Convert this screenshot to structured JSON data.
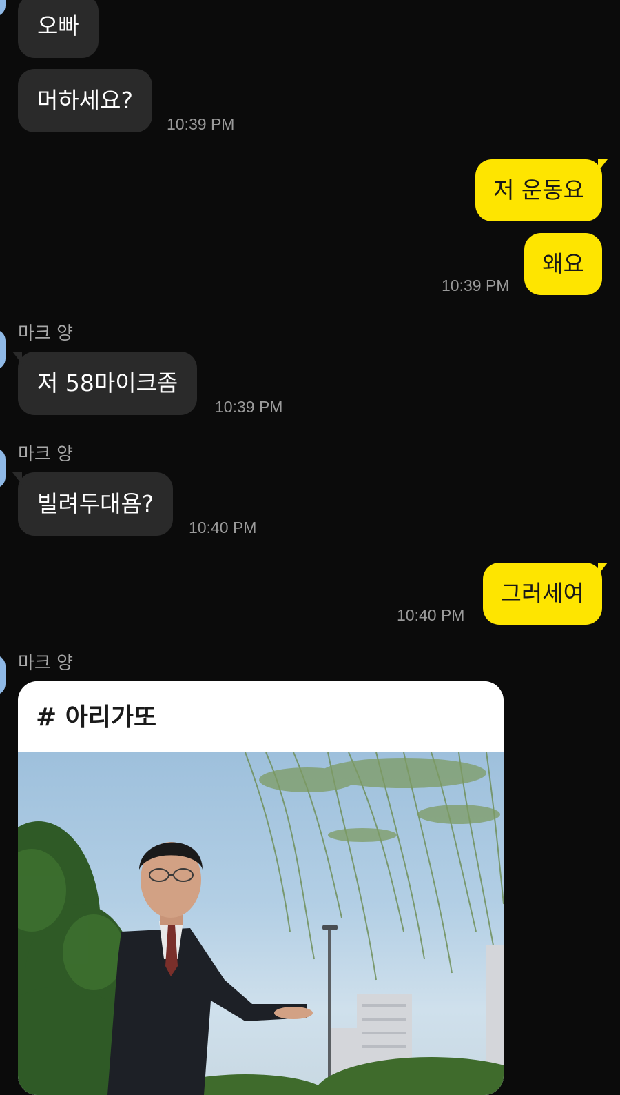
{
  "messages": [
    {
      "text": "오빠"
    },
    {
      "text": "머하세요?",
      "time": "10:39 PM"
    },
    {
      "text": "저 운동요"
    },
    {
      "text": "왜요",
      "time": "10:39 PM"
    },
    {
      "sender": "마크 양",
      "text": "저 58마이크좀",
      "time": "10:39 PM"
    },
    {
      "sender": "마크 양",
      "text": "빌려두대욤?",
      "time": "10:40 PM"
    },
    {
      "text": "그러세여",
      "time": "10:40 PM"
    },
    {
      "sender": "마크 양"
    }
  ],
  "card": {
    "title": "# 아리가또",
    "image_alt": "man in suit gesturing under willow tree"
  },
  "colors": {
    "background": "#0b0b0b",
    "incoming_bubble": "#2a2a2a",
    "outgoing_bubble": "#fee500",
    "timestamp": "#9a9a9a"
  }
}
